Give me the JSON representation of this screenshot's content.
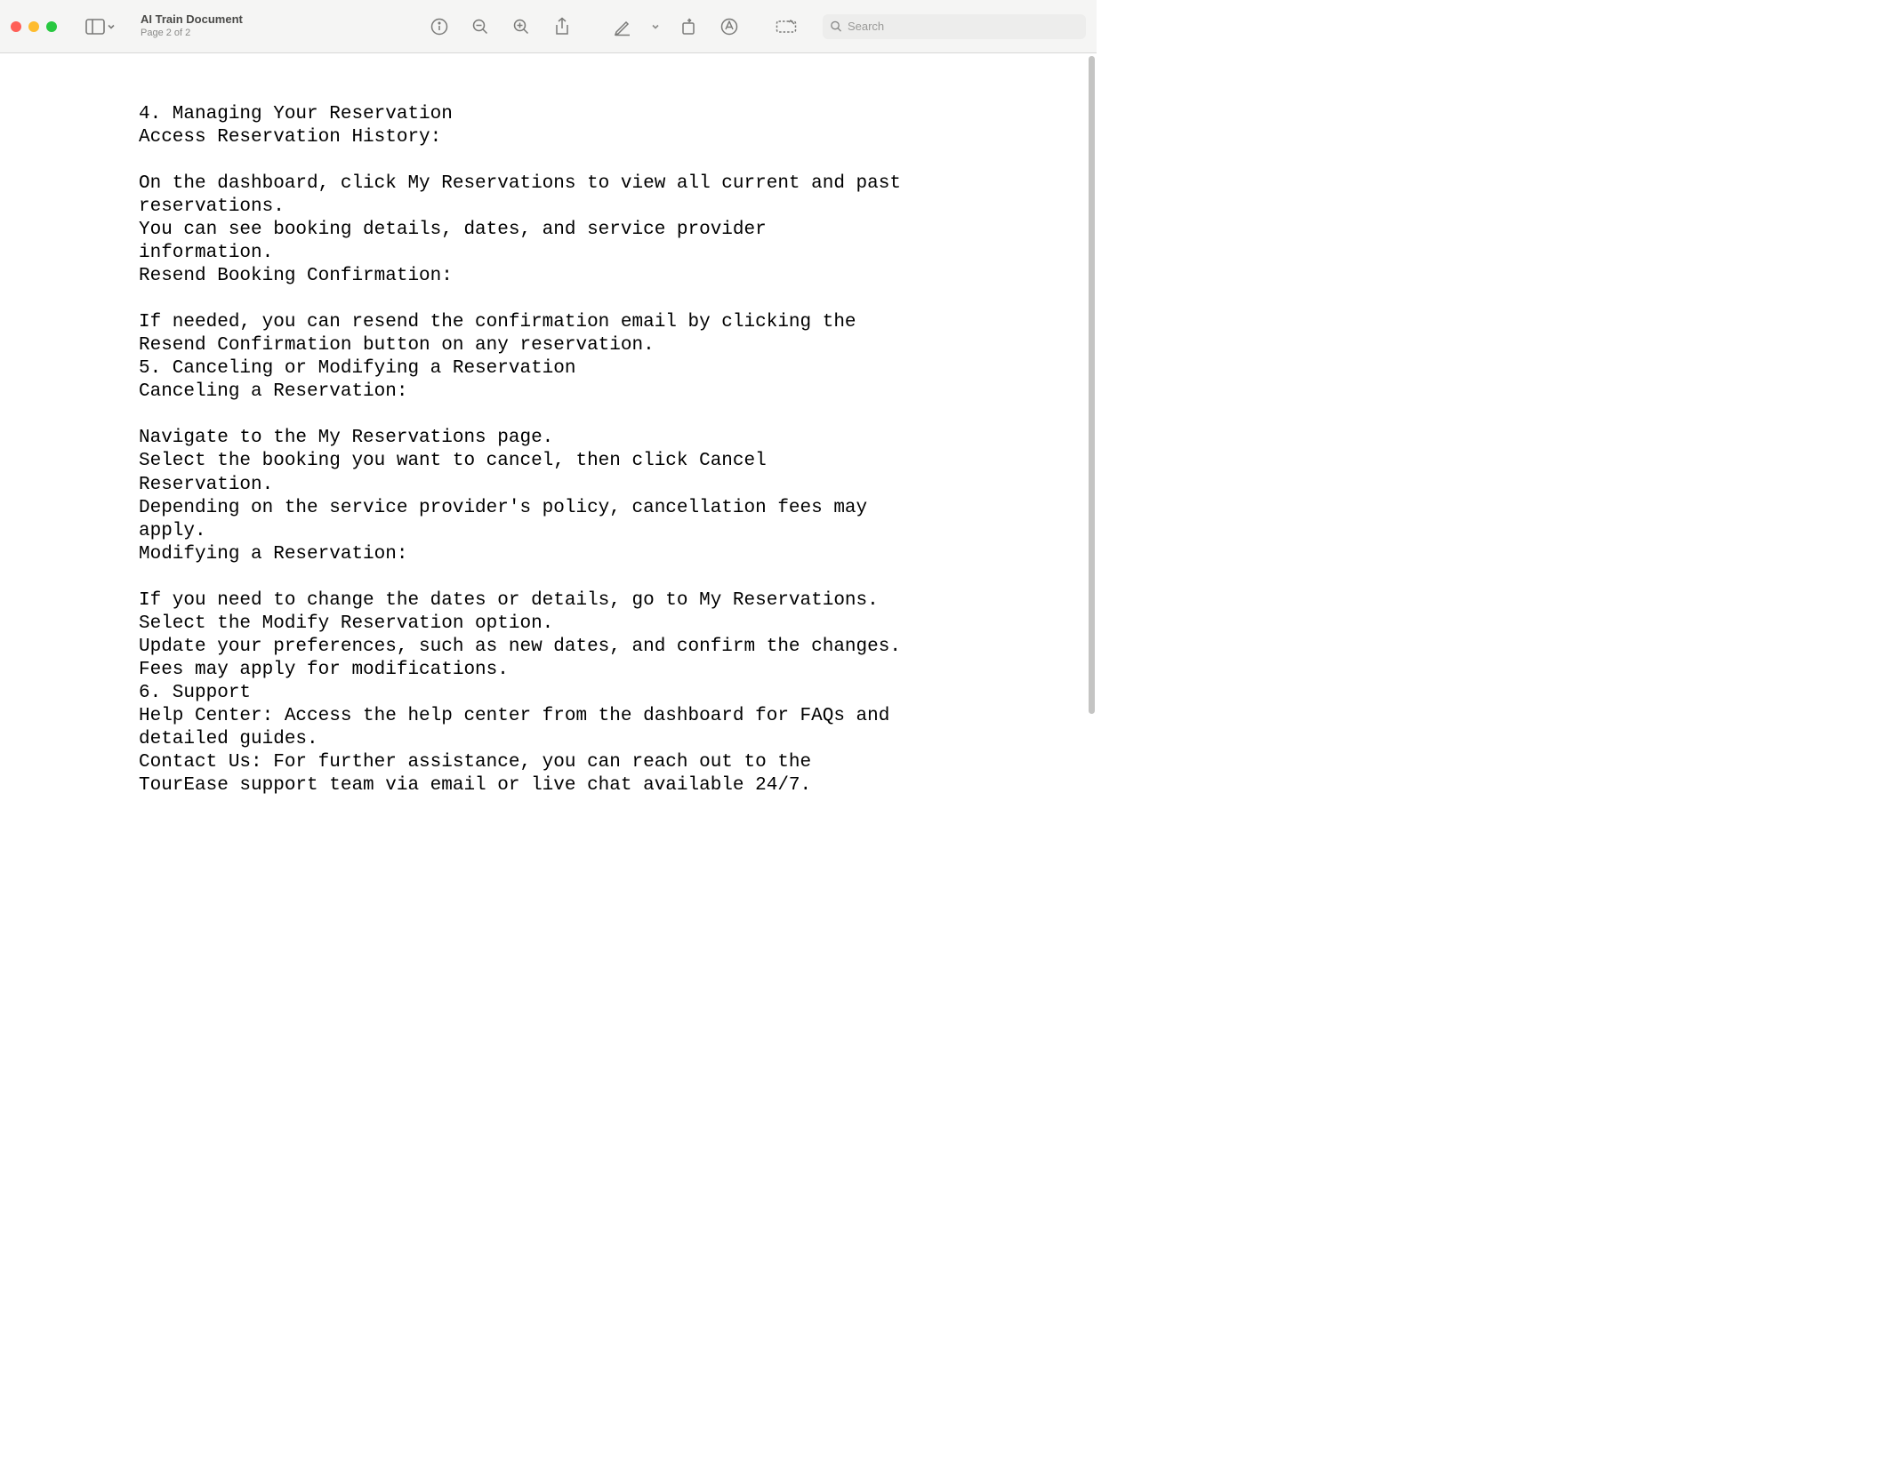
{
  "header": {
    "doc_title": "AI Train Document",
    "page_info": "Page 2 of 2",
    "search_placeholder": "Search"
  },
  "document": {
    "text": "4. Managing Your Reservation\nAccess Reservation History:\n\nOn the dashboard, click My Reservations to view all current and past reservations.\nYou can see booking details, dates, and service provider information.\nResend Booking Confirmation:\n\nIf needed, you can resend the confirmation email by clicking the Resend Confirmation button on any reservation.\n5. Canceling or Modifying a Reservation\nCanceling a Reservation:\n\nNavigate to the My Reservations page.\nSelect the booking you want to cancel, then click Cancel Reservation.\nDepending on the service provider's policy, cancellation fees may apply.\nModifying a Reservation:\n\nIf you need to change the dates or details, go to My Reservations.\nSelect the Modify Reservation option.\nUpdate your preferences, such as new dates, and confirm the changes. Fees may apply for modifications.\n6. Support\nHelp Center: Access the help center from the dashboard for FAQs and detailed guides.\nContact Us: For further assistance, you can reach out to the TourEase support team via email or live chat available 24/7."
  }
}
